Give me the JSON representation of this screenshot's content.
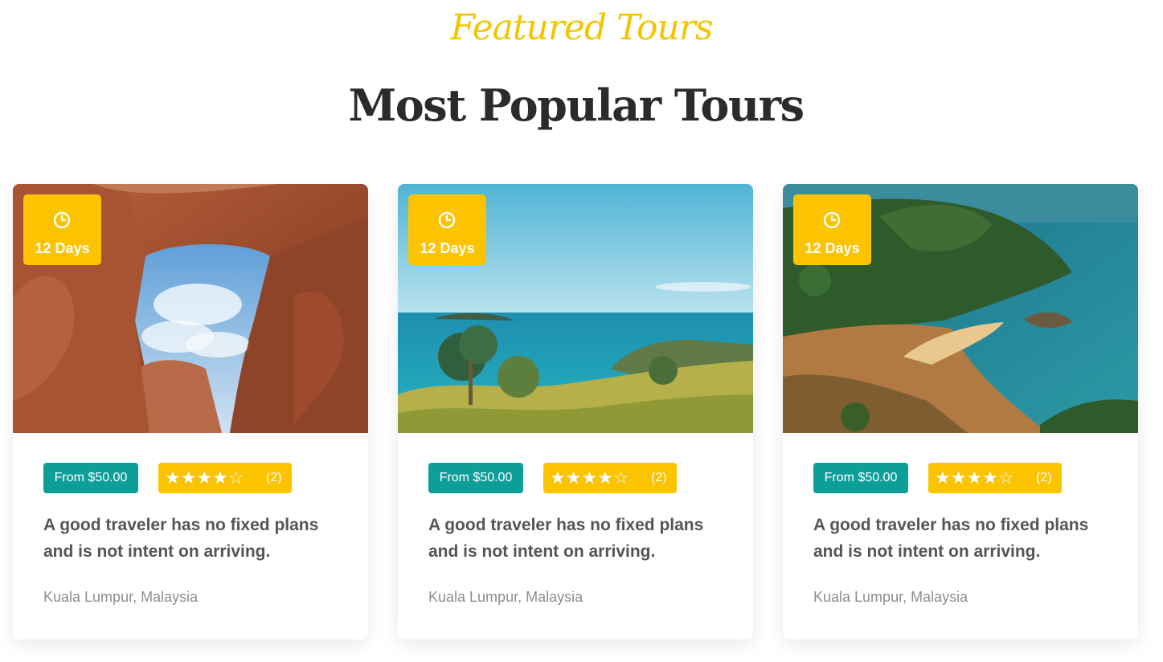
{
  "section": {
    "eyebrow": "Featured Tours",
    "heading": "Most Popular Tours"
  },
  "tours": [
    {
      "duration": "12 Days",
      "price": "From $50.00",
      "rating_stars": "★★★★☆",
      "rating_value": 4,
      "review_count": "(2)",
      "title": "A good traveler has no fixed plans and is not intent on arriving.",
      "location": "Kuala Lumpur, Malaysia",
      "image": "red rock arch canyon"
    },
    {
      "duration": "12 Days",
      "price": "From $50.00",
      "rating_stars": "★★★★☆",
      "rating_value": 4,
      "review_count": "(2)",
      "title": "A good traveler has no fixed plans and is not intent on arriving.",
      "location": "Kuala Lumpur, Malaysia",
      "image": "turquoise sea coastline"
    },
    {
      "duration": "12 Days",
      "price": "From $50.00",
      "rating_stars": "★★★★☆",
      "rating_value": 4,
      "review_count": "(2)",
      "title": "A good traveler has no fixed plans and is not intent on arriving.",
      "location": "Kuala Lumpur, Malaysia",
      "image": "tropical bay beach"
    }
  ],
  "colors": {
    "accent_yellow": "#fcc300",
    "teal": "#0e9e9a",
    "heading": "#2b2b2b",
    "text": "#555555",
    "muted": "#8e8e8e"
  }
}
